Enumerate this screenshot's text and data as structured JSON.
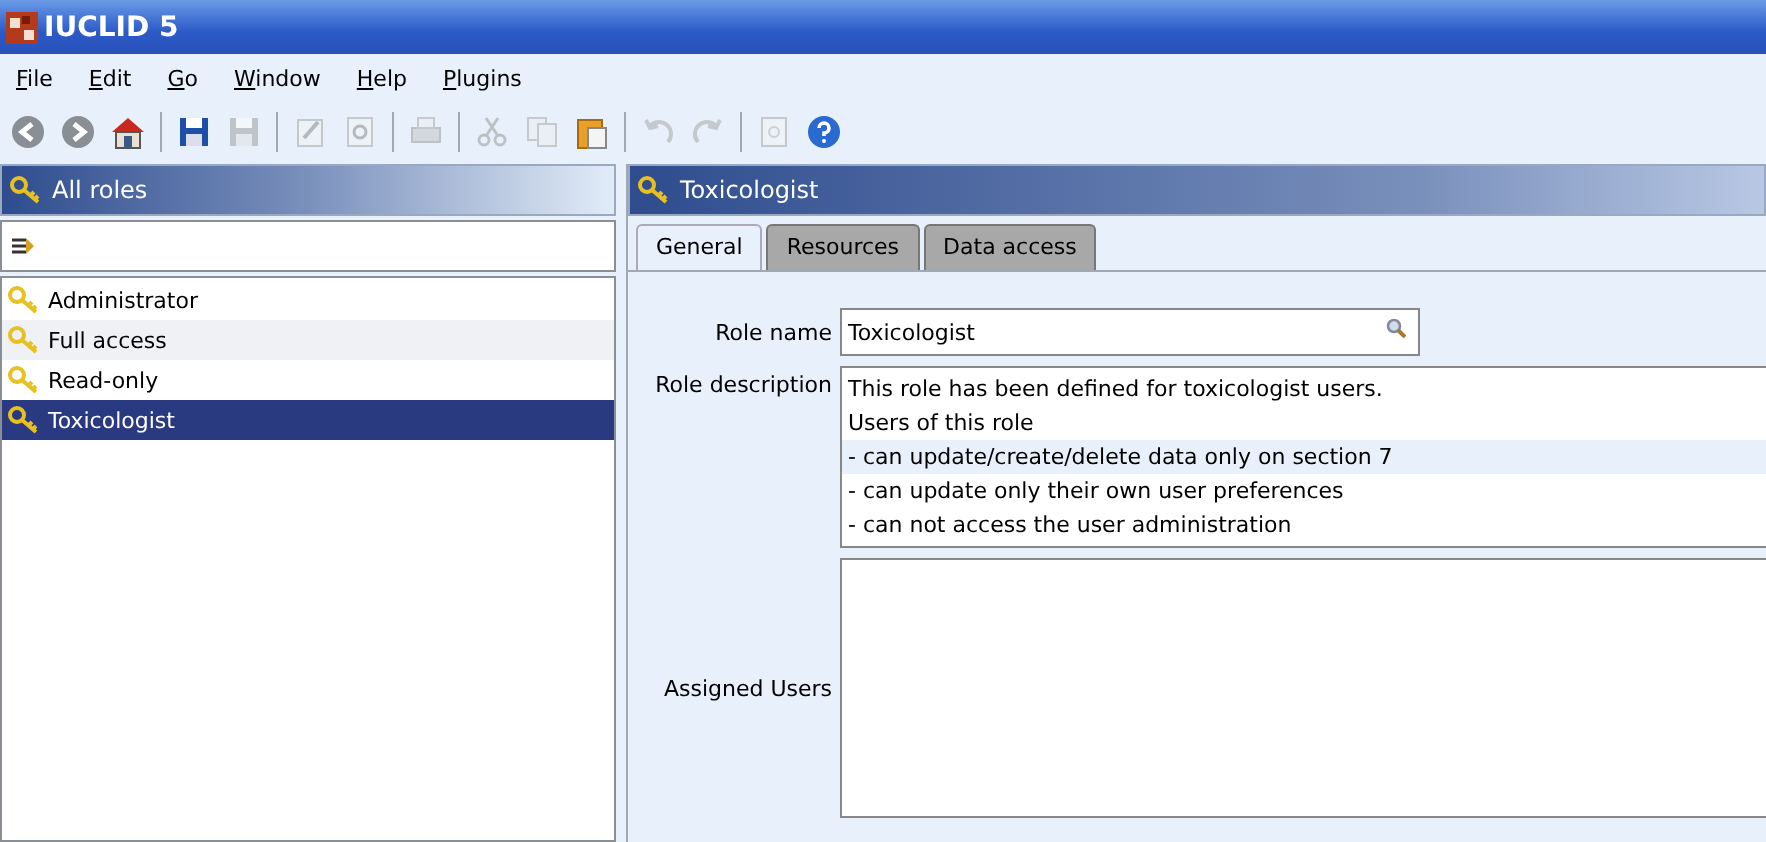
{
  "window": {
    "title": "IUCLID 5"
  },
  "menu": [
    "File",
    "Edit",
    "Go",
    "Window",
    "Help",
    "Plugins"
  ],
  "toolbar": [
    {
      "kind": "back",
      "disabled": false
    },
    {
      "kind": "forward",
      "disabled": false
    },
    {
      "kind": "home",
      "disabled": false
    },
    {
      "kind": "separator"
    },
    {
      "kind": "save",
      "disabled": false
    },
    {
      "kind": "save-close",
      "disabled": true
    },
    {
      "kind": "separator"
    },
    {
      "kind": "edit",
      "disabled": true
    },
    {
      "kind": "preview",
      "disabled": true
    },
    {
      "kind": "separator"
    },
    {
      "kind": "print",
      "disabled": true
    },
    {
      "kind": "separator"
    },
    {
      "kind": "cut",
      "disabled": true
    },
    {
      "kind": "copy",
      "disabled": true
    },
    {
      "kind": "paste",
      "disabled": false
    },
    {
      "kind": "separator"
    },
    {
      "kind": "undo",
      "disabled": true
    },
    {
      "kind": "redo",
      "disabled": true
    },
    {
      "kind": "separator"
    },
    {
      "kind": "document",
      "disabled": true
    },
    {
      "kind": "help",
      "disabled": false
    }
  ],
  "left_panel": {
    "title": "All roles",
    "roles": [
      {
        "label": "Administrator",
        "selected": false
      },
      {
        "label": "Full access",
        "selected": false
      },
      {
        "label": "Read-only",
        "selected": false
      },
      {
        "label": "Toxicologist",
        "selected": true
      }
    ]
  },
  "right_panel": {
    "title": "Toxicologist",
    "tabs": [
      {
        "label": "General",
        "selected": true
      },
      {
        "label": "Resources",
        "selected": false
      },
      {
        "label": "Data access",
        "selected": false
      }
    ],
    "role_name": {
      "label": "Role name",
      "value": "Toxicologist"
    },
    "role_description": {
      "label": "Role description",
      "lines": [
        {
          "text": "This role has been defined for toxicologist users.",
          "selected": false
        },
        {
          "text": "Users of this role",
          "selected": false
        },
        {
          "text": "- can update/create/delete data only on section 7",
          "selected": true
        },
        {
          "text": "- can update only their own user preferences",
          "selected": false
        },
        {
          "text": "- can not access the user administration",
          "selected": false
        }
      ]
    },
    "assigned_users": {
      "label": "Assigned Users"
    }
  }
}
